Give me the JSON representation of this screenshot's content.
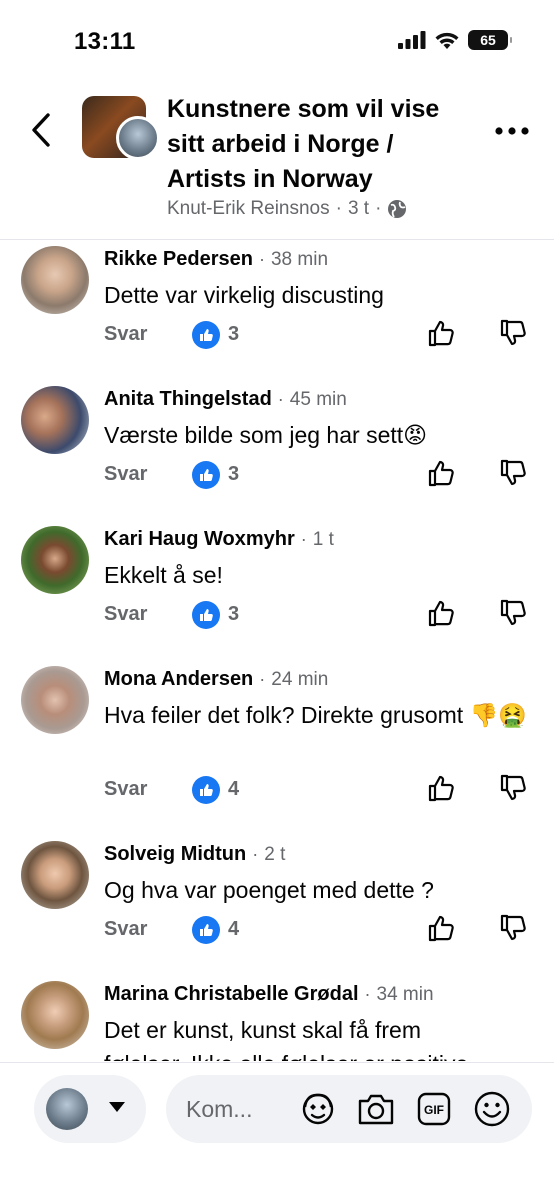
{
  "status_bar": {
    "time": "13:11",
    "battery": "65"
  },
  "header": {
    "title": "Kunstnere som vil vise sitt arbeid i Norge / Artists in Norway",
    "author": "Knut-Erik Reinsnos",
    "separator": "·",
    "age": "3 t",
    "icons": {
      "back": "chevron-left-icon",
      "privacy": "globe-icon",
      "more": "more-dots-icon"
    }
  },
  "comments": [
    {
      "name": "Rikke Pedersen",
      "time": "38 min",
      "text": "Dette var virkelig discusting",
      "reply": "Svar",
      "likes": "3"
    },
    {
      "name": "Anita Thingelstad",
      "time": "45 min",
      "text": "Værste bilde som jeg har sett😡",
      "reply": "Svar",
      "likes": "3"
    },
    {
      "name": "Kari Haug Woxmyhr",
      "time": "1 t",
      "text": "Ekkelt å se!",
      "reply": "Svar",
      "likes": "3"
    },
    {
      "name": "Mona Andersen",
      "time": "24 min",
      "text": "Hva feiler det folk? Direkte grusomt 👎🤮",
      "reply": "Svar",
      "likes": "4"
    },
    {
      "name": "Solveig Midtun",
      "time": "2 t",
      "text": "Og hva var poenget med dette ?",
      "reply": "Svar",
      "likes": "4"
    },
    {
      "name": "Marina Christabelle Grødal",
      "time": "34 min",
      "text": "Det er kunst, kunst skal få frem følelser. Ikke alle følelser er positive",
      "reply": "",
      "likes": ""
    }
  ],
  "composer": {
    "placeholder": "Kom...",
    "icons": [
      "avatar-sticker-icon",
      "camera-icon",
      "gif-icon",
      "emoji-icon"
    ]
  },
  "colors": {
    "accent": "#1877f2",
    "muted": "#65676b",
    "text": "#050505",
    "field": "#f0f2f5"
  }
}
